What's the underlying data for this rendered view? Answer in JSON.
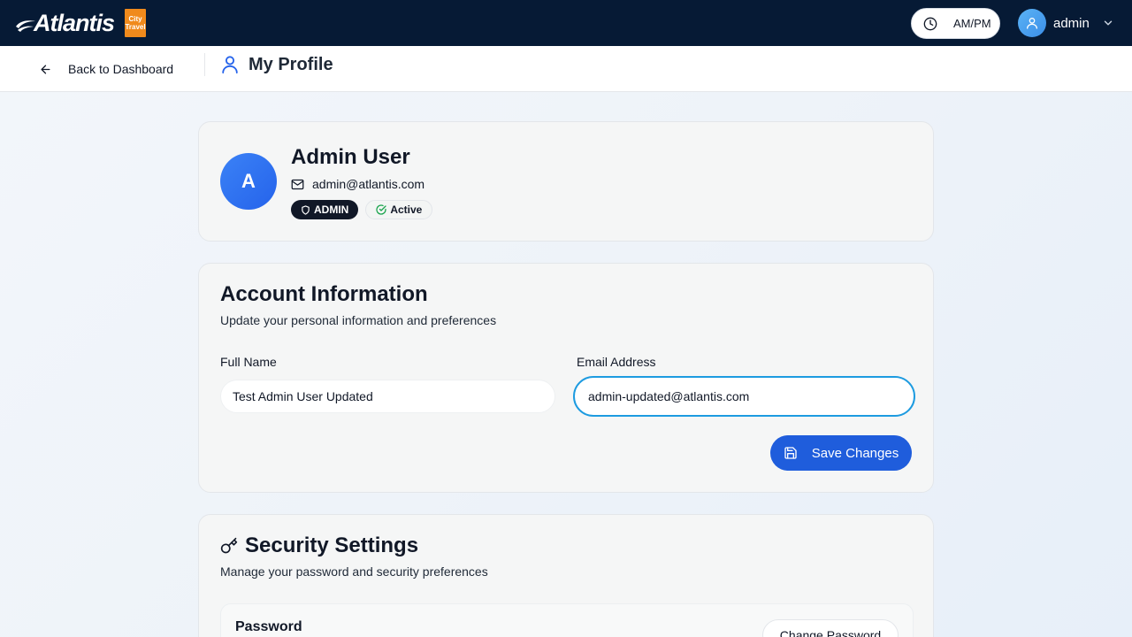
{
  "topbar": {
    "logo_text": "Atlantis",
    "logo_badge_lines": [
      "City",
      "Travel"
    ],
    "time_format_label": "AM/PM",
    "username": "admin"
  },
  "subheader": {
    "back_label": "Back to Dashboard",
    "page_title": "My Profile"
  },
  "profile": {
    "avatar_initial": "A",
    "name": "Admin User",
    "email": "admin@atlantis.com",
    "role_badge": "ADMIN",
    "status_badge": "Active"
  },
  "account": {
    "title": "Account Information",
    "description": "Update your personal information and preferences",
    "full_name_label": "Full Name",
    "full_name_value": "Test Admin User Updated",
    "email_label": "Email Address",
    "email_value": "admin-updated@atlantis.com",
    "save_label": "Save Changes"
  },
  "security": {
    "title": "Security Settings",
    "description": "Manage your password and security preferences",
    "password_label": "Password",
    "change_password_label": "Change Password"
  },
  "colors": {
    "topbar_bg": "#061a35",
    "accent_blue": "#1f5ddc",
    "focus_ring": "#1d9be0",
    "active_green": "#16a34a",
    "logo_orange": "#f08a1c"
  },
  "icons": {
    "clock": "clock-icon",
    "user": "user-icon",
    "chevron": "chevron-down-icon",
    "back": "arrow-left-icon",
    "mail": "mail-icon",
    "shield": "shield-icon",
    "check": "check-circle-icon",
    "save": "save-icon",
    "key": "key-icon"
  }
}
